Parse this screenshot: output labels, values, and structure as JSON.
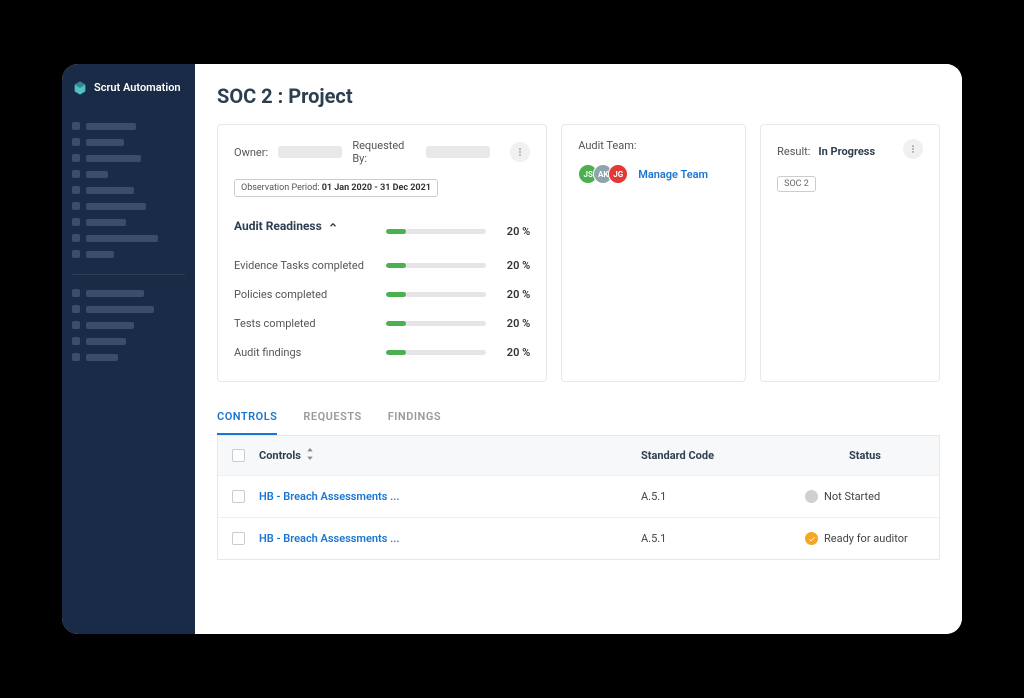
{
  "logo": {
    "name": "Scrut Automation"
  },
  "page_title": "SOC 2 : Project",
  "owner_label": "Owner:",
  "requested_by_label": "Requested By:",
  "observation_period": {
    "label": "Observation Period:",
    "value": "01 Jan 2020 - 31 Dec 2021"
  },
  "readiness": {
    "header": "Audit Readiness",
    "rows": [
      {
        "label": "Evidence Tasks completed",
        "pct": 20
      },
      {
        "label": "Policies completed",
        "pct": 20
      },
      {
        "label": "Tests completed",
        "pct": 20
      },
      {
        "label": "Audit findings",
        "pct": 20
      }
    ],
    "overall_pct": 20
  },
  "audit_team": {
    "label": "Audit Team:",
    "members": [
      {
        "initials": "JS",
        "color": "#4caf50"
      },
      {
        "initials": "AK",
        "color": "#90a4ae"
      },
      {
        "initials": "JG",
        "color": "#e53935"
      }
    ],
    "manage_label": "Manage Team"
  },
  "result": {
    "label": "Result:",
    "value": "In Progress",
    "badge": "SOC 2"
  },
  "tabs": [
    {
      "label": "CONTROLS",
      "active": true
    },
    {
      "label": "REQUESTS",
      "active": false
    },
    {
      "label": "FINDINGS",
      "active": false
    }
  ],
  "table": {
    "headers": {
      "controls": "Controls",
      "standard": "Standard Code",
      "status": "Status"
    },
    "rows": [
      {
        "control": "HB - Breach Assessments ...",
        "standard": "A.5.1",
        "status": "Not Started",
        "status_color": "gray"
      },
      {
        "control": "HB - Breach Assessments ...",
        "standard": "A.5.1",
        "status": "Ready for auditor",
        "status_color": "orange"
      }
    ]
  }
}
